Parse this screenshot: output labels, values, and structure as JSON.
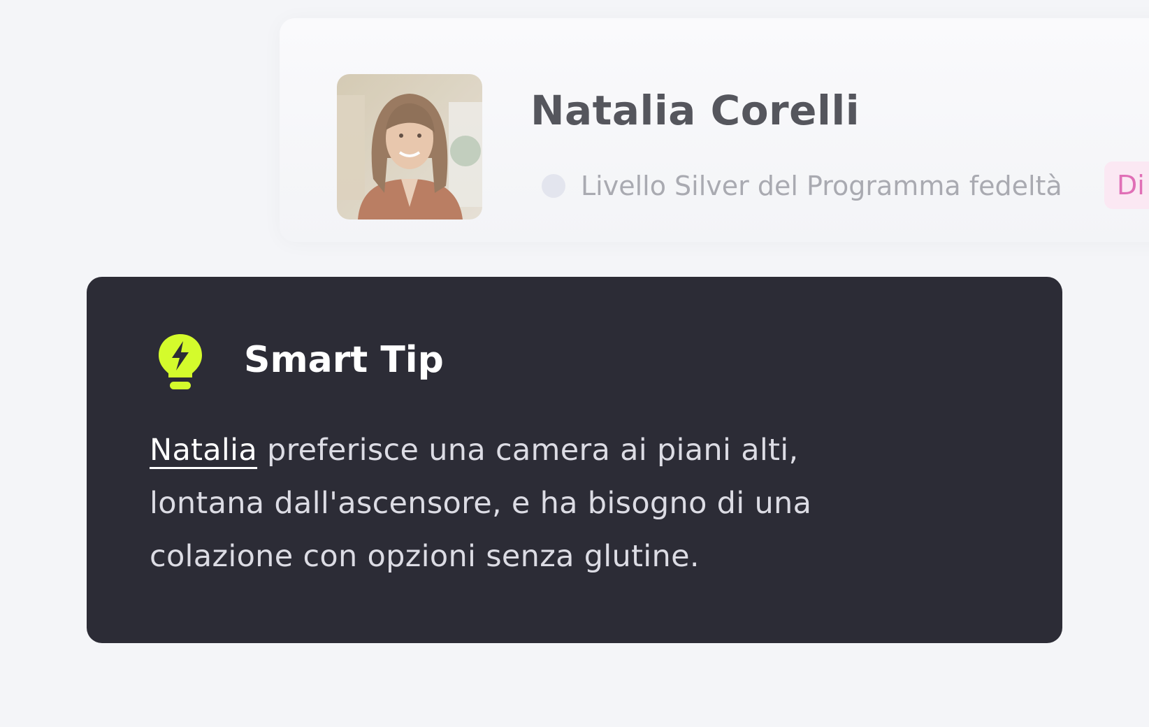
{
  "guest": {
    "name": "Natalia Corelli",
    "tier_label": "Livello Silver del Programma fedeltà",
    "tag_label": "Di"
  },
  "smart_tip": {
    "title": "Smart Tip",
    "icon": "lightbulb-bolt-icon",
    "name_link": "Natalia",
    "body": " preferisce una camera ai piani alti, lontana dall'ascensore, e ha bisogno di una colazione con opzioni senza glutine."
  },
  "colors": {
    "tip_background": "#2c2c36",
    "tip_icon": "#d4fb2c",
    "tag_text": "#e06fb6",
    "tag_background": "#fbe8f3",
    "page_background": "#f4f5f8"
  }
}
